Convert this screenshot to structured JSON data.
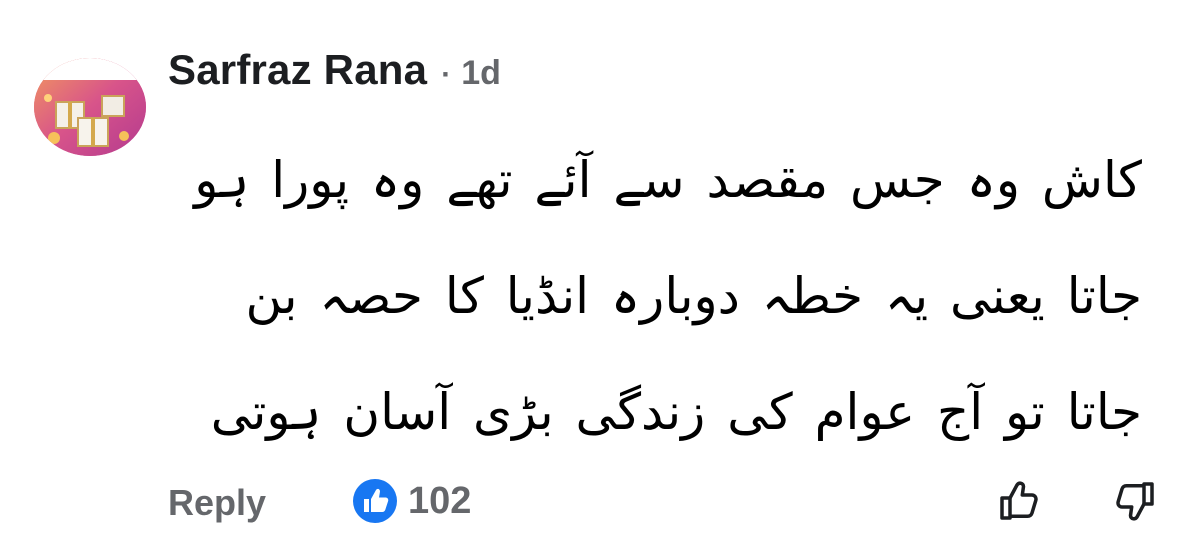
{
  "comment": {
    "author": "Sarfraz Rana",
    "separator": "·",
    "time": "1d",
    "text": "کاش وہ جس مقصد سے آئے تھے وہ پورا ہو جاتا یعنی یہ خطہ دوبارہ انڈیا کا حصہ بن جاتا تو آج عوام کی زندگی بڑی آسان ہوتی",
    "avatar_icon": "gift-boxes-avatar"
  },
  "footer": {
    "reply_label": "Reply",
    "reaction_icon": "thumbs-up-reaction-icon",
    "reaction_count": "102",
    "like_icon": "thumbs-up-outline-icon",
    "dislike_icon": "thumbs-down-outline-icon"
  },
  "colors": {
    "text": "#1c1e21",
    "muted": "#65676b",
    "reaction_blue": "#1877f2"
  }
}
